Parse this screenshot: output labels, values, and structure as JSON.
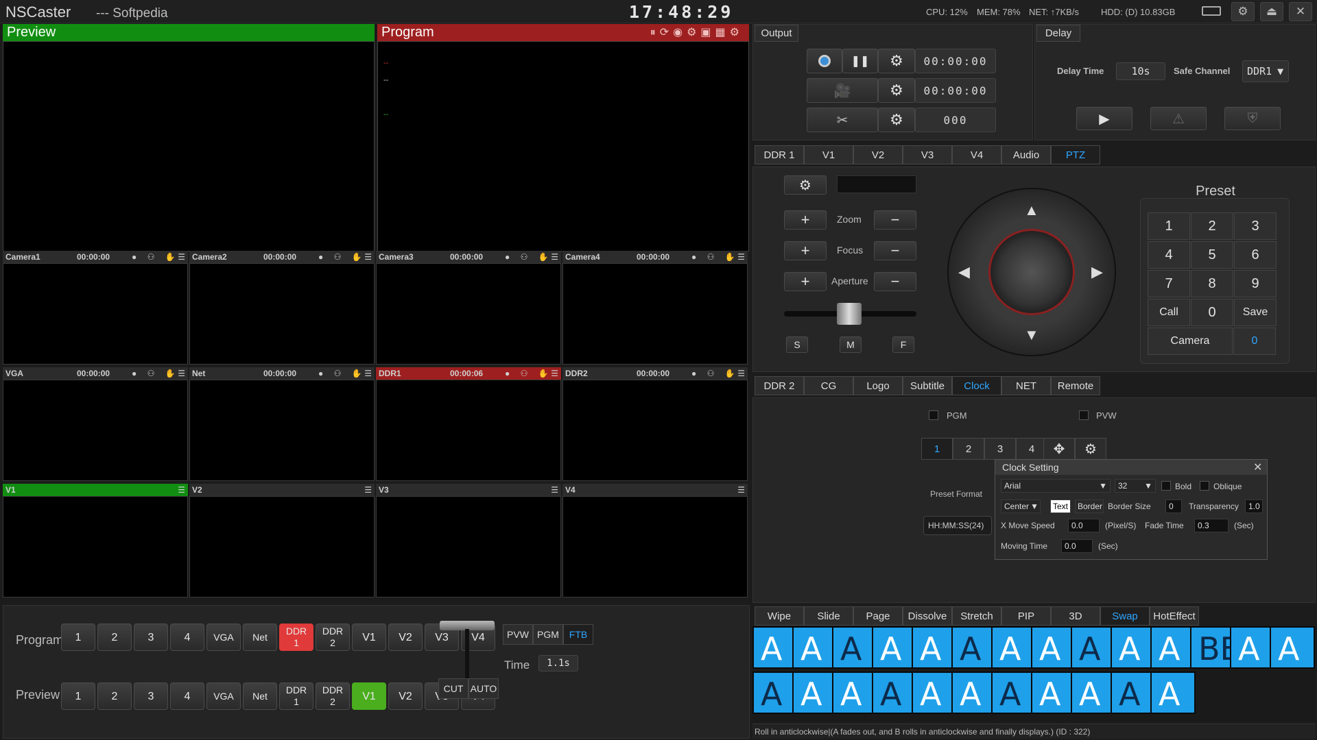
{
  "app": {
    "name": "NSCaster",
    "subtitle": "--- Softpedia",
    "clock": "17:48:29",
    "cpu": "CPU:  12%",
    "mem": "MEM:  78%",
    "net": "NET:   ↑7KB/s",
    "hdd": "HDD: (D) 10.83GB"
  },
  "monitors": {
    "preview": "Preview",
    "program": "Program",
    "program_lines": [
      "--",
      "--",
      "--"
    ]
  },
  "tiles": [
    {
      "name": "Camera1",
      "time": "00:00:00"
    },
    {
      "name": "Camera2",
      "time": "00:00:00"
    },
    {
      "name": "Camera3",
      "time": "00:00:00"
    },
    {
      "name": "Camera4",
      "time": "00:00:00"
    },
    {
      "name": "VGA",
      "time": "00:00:00"
    },
    {
      "name": "Net",
      "time": "00:00:00"
    },
    {
      "name": "DDR1",
      "time": "00:00:06"
    },
    {
      "name": "DDR2",
      "time": "00:00:00"
    },
    {
      "name": "V1",
      "time": ""
    },
    {
      "name": "V2",
      "time": ""
    },
    {
      "name": "V3",
      "time": ""
    },
    {
      "name": "V4",
      "time": ""
    }
  ],
  "output": {
    "title": "Output",
    "rec_time": "00:00:00",
    "stream_time": "00:00:00",
    "clip_count": "000"
  },
  "delay": {
    "title": "Delay",
    "delay_label": "Delay Time",
    "delay_value": "10s",
    "safe_label": "Safe Channel",
    "safe_value": "DDR1"
  },
  "tabs1": [
    "DDR 1",
    "V1",
    "V2",
    "V3",
    "V4",
    "Audio",
    "PTZ"
  ],
  "ptz": {
    "zoom": "Zoom",
    "focus": "Focus",
    "aperture": "Aperture",
    "s": "S",
    "m": "M",
    "f": "F",
    "preset_title": "Preset",
    "keys": [
      "1",
      "2",
      "3",
      "4",
      "5",
      "6",
      "7",
      "8",
      "9",
      "Call",
      "0",
      "Save"
    ],
    "camera_label": "Camera",
    "camera_value": "0"
  },
  "tabs2": [
    "DDR 2",
    "CG",
    "Logo",
    "Subtitle",
    "Clock",
    "NET",
    "Remote"
  ],
  "clock_panel": {
    "pgm": "PGM",
    "pvw": "PVW",
    "nums": [
      "1",
      "2",
      "3",
      "4"
    ],
    "preset_format": "Preset Format",
    "format_value": "HH:MM:SS(24)"
  },
  "clock_setting": {
    "title": "Clock Setting",
    "font": "Arial",
    "size": "32",
    "bold": "Bold",
    "oblique": "Oblique",
    "align": "Center",
    "text": "Text",
    "border": "Border",
    "border_size_lbl": "Border Size",
    "border_size": "0",
    "transparency_lbl": "Transparency",
    "transparency": "1.0",
    "x_move_lbl": "X Move Speed",
    "x_move": "0.0",
    "pixel_unit": "(Pixel/S)",
    "fade_lbl": "Fade Time",
    "fade": "0.3",
    "sec": "(Sec)",
    "moving_lbl": "Moving Time",
    "moving": "0.0"
  },
  "switcher": {
    "program": "Program",
    "preview": "Preview",
    "buttons": [
      "1",
      "2",
      "3",
      "4",
      "VGA",
      "Net",
      "DDR\n1",
      "DDR\n2",
      "V1",
      "V2",
      "V3",
      "V4"
    ],
    "pvw": "PVW",
    "pgm": "PGM",
    "ftb": "FTB",
    "time_lbl": "Time",
    "time_val": "1.1s",
    "cut": "CUT",
    "auto": "AUTO"
  },
  "tabs3": [
    "Wipe",
    "Slide",
    "Page",
    "Dissolve",
    "Stretch",
    "PIP",
    "3D",
    "Swap",
    "HotEffect"
  ],
  "status": "Roll in anticlockwise|(A fades out, and B rolls in anticlockwise and finally displays.) (ID : 322)",
  "thumbs": [
    "A",
    "A",
    "A",
    "A",
    "A",
    "A",
    "A",
    "A",
    "A",
    "A",
    "A",
    "BBA",
    "A",
    "A",
    "A",
    "A",
    "A",
    "A",
    "A",
    "A",
    "A",
    "A",
    "A",
    "A",
    "A"
  ]
}
